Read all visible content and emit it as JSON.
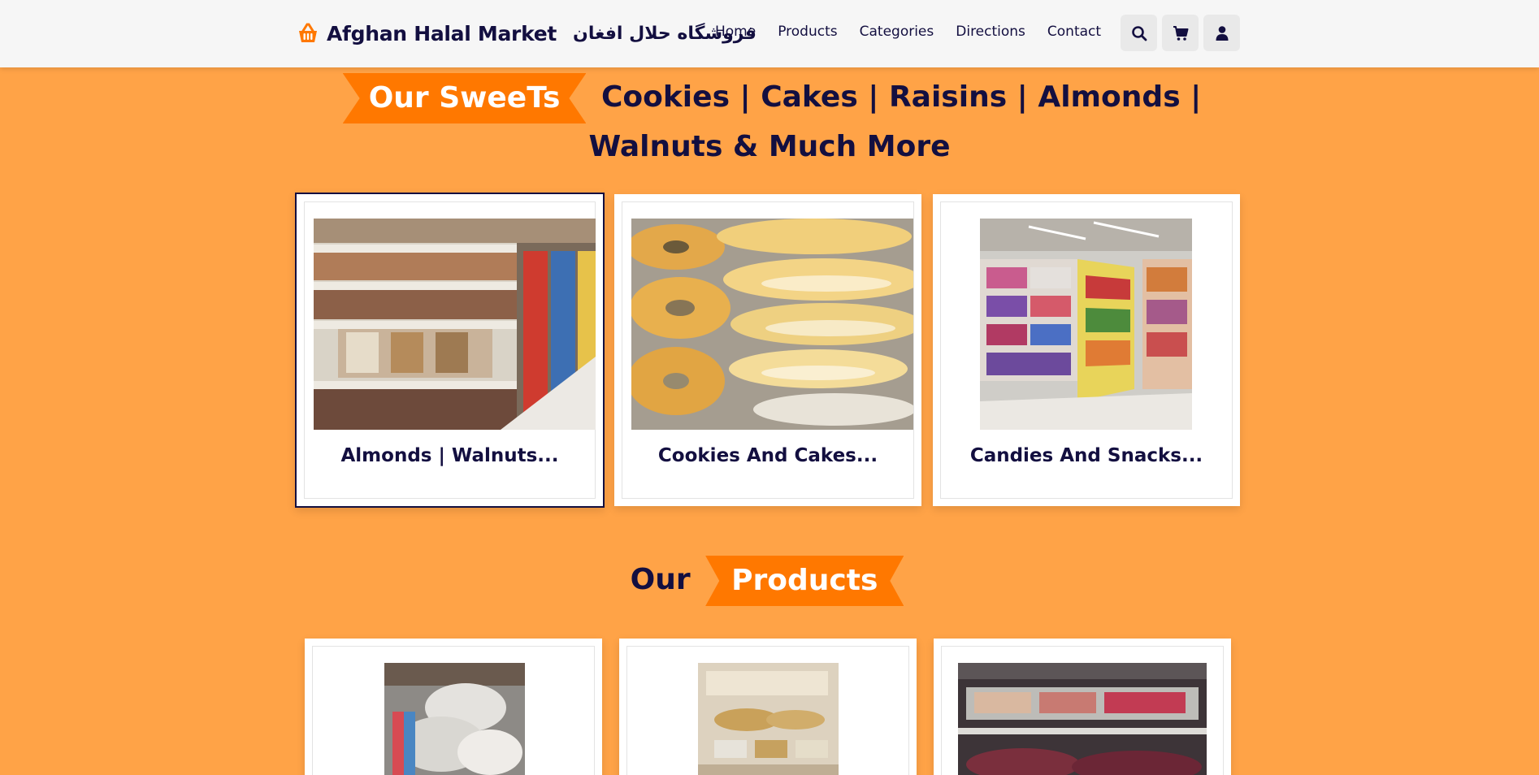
{
  "brand": {
    "name": "Afghan Halal Market",
    "farsi": "فروشگاه حلال افغان",
    "icon": "shopping-basket-icon"
  },
  "nav": [
    {
      "label": "Home"
    },
    {
      "label": "Products"
    },
    {
      "label": "Categories"
    },
    {
      "label": "Directions"
    },
    {
      "label": "Contact"
    }
  ],
  "header_icons": [
    "search-icon",
    "cart-icon",
    "user-icon"
  ],
  "sweets_section": {
    "highlight": "Our SweeTs",
    "heading": "Cookies | Cakes | Raisins | Almonds | Walnuts & Much More",
    "cards": [
      {
        "title": "Almonds | Walnuts..."
      },
      {
        "title": "Cookies And Cakes..."
      },
      {
        "title": "Candies And Snacks..."
      }
    ]
  },
  "products_section": {
    "prefix": "Our",
    "highlight": "Products"
  },
  "colors": {
    "background": "#ffa347",
    "accent": "#ff7800",
    "text": "#130f40",
    "header": "#f6f6f6"
  }
}
